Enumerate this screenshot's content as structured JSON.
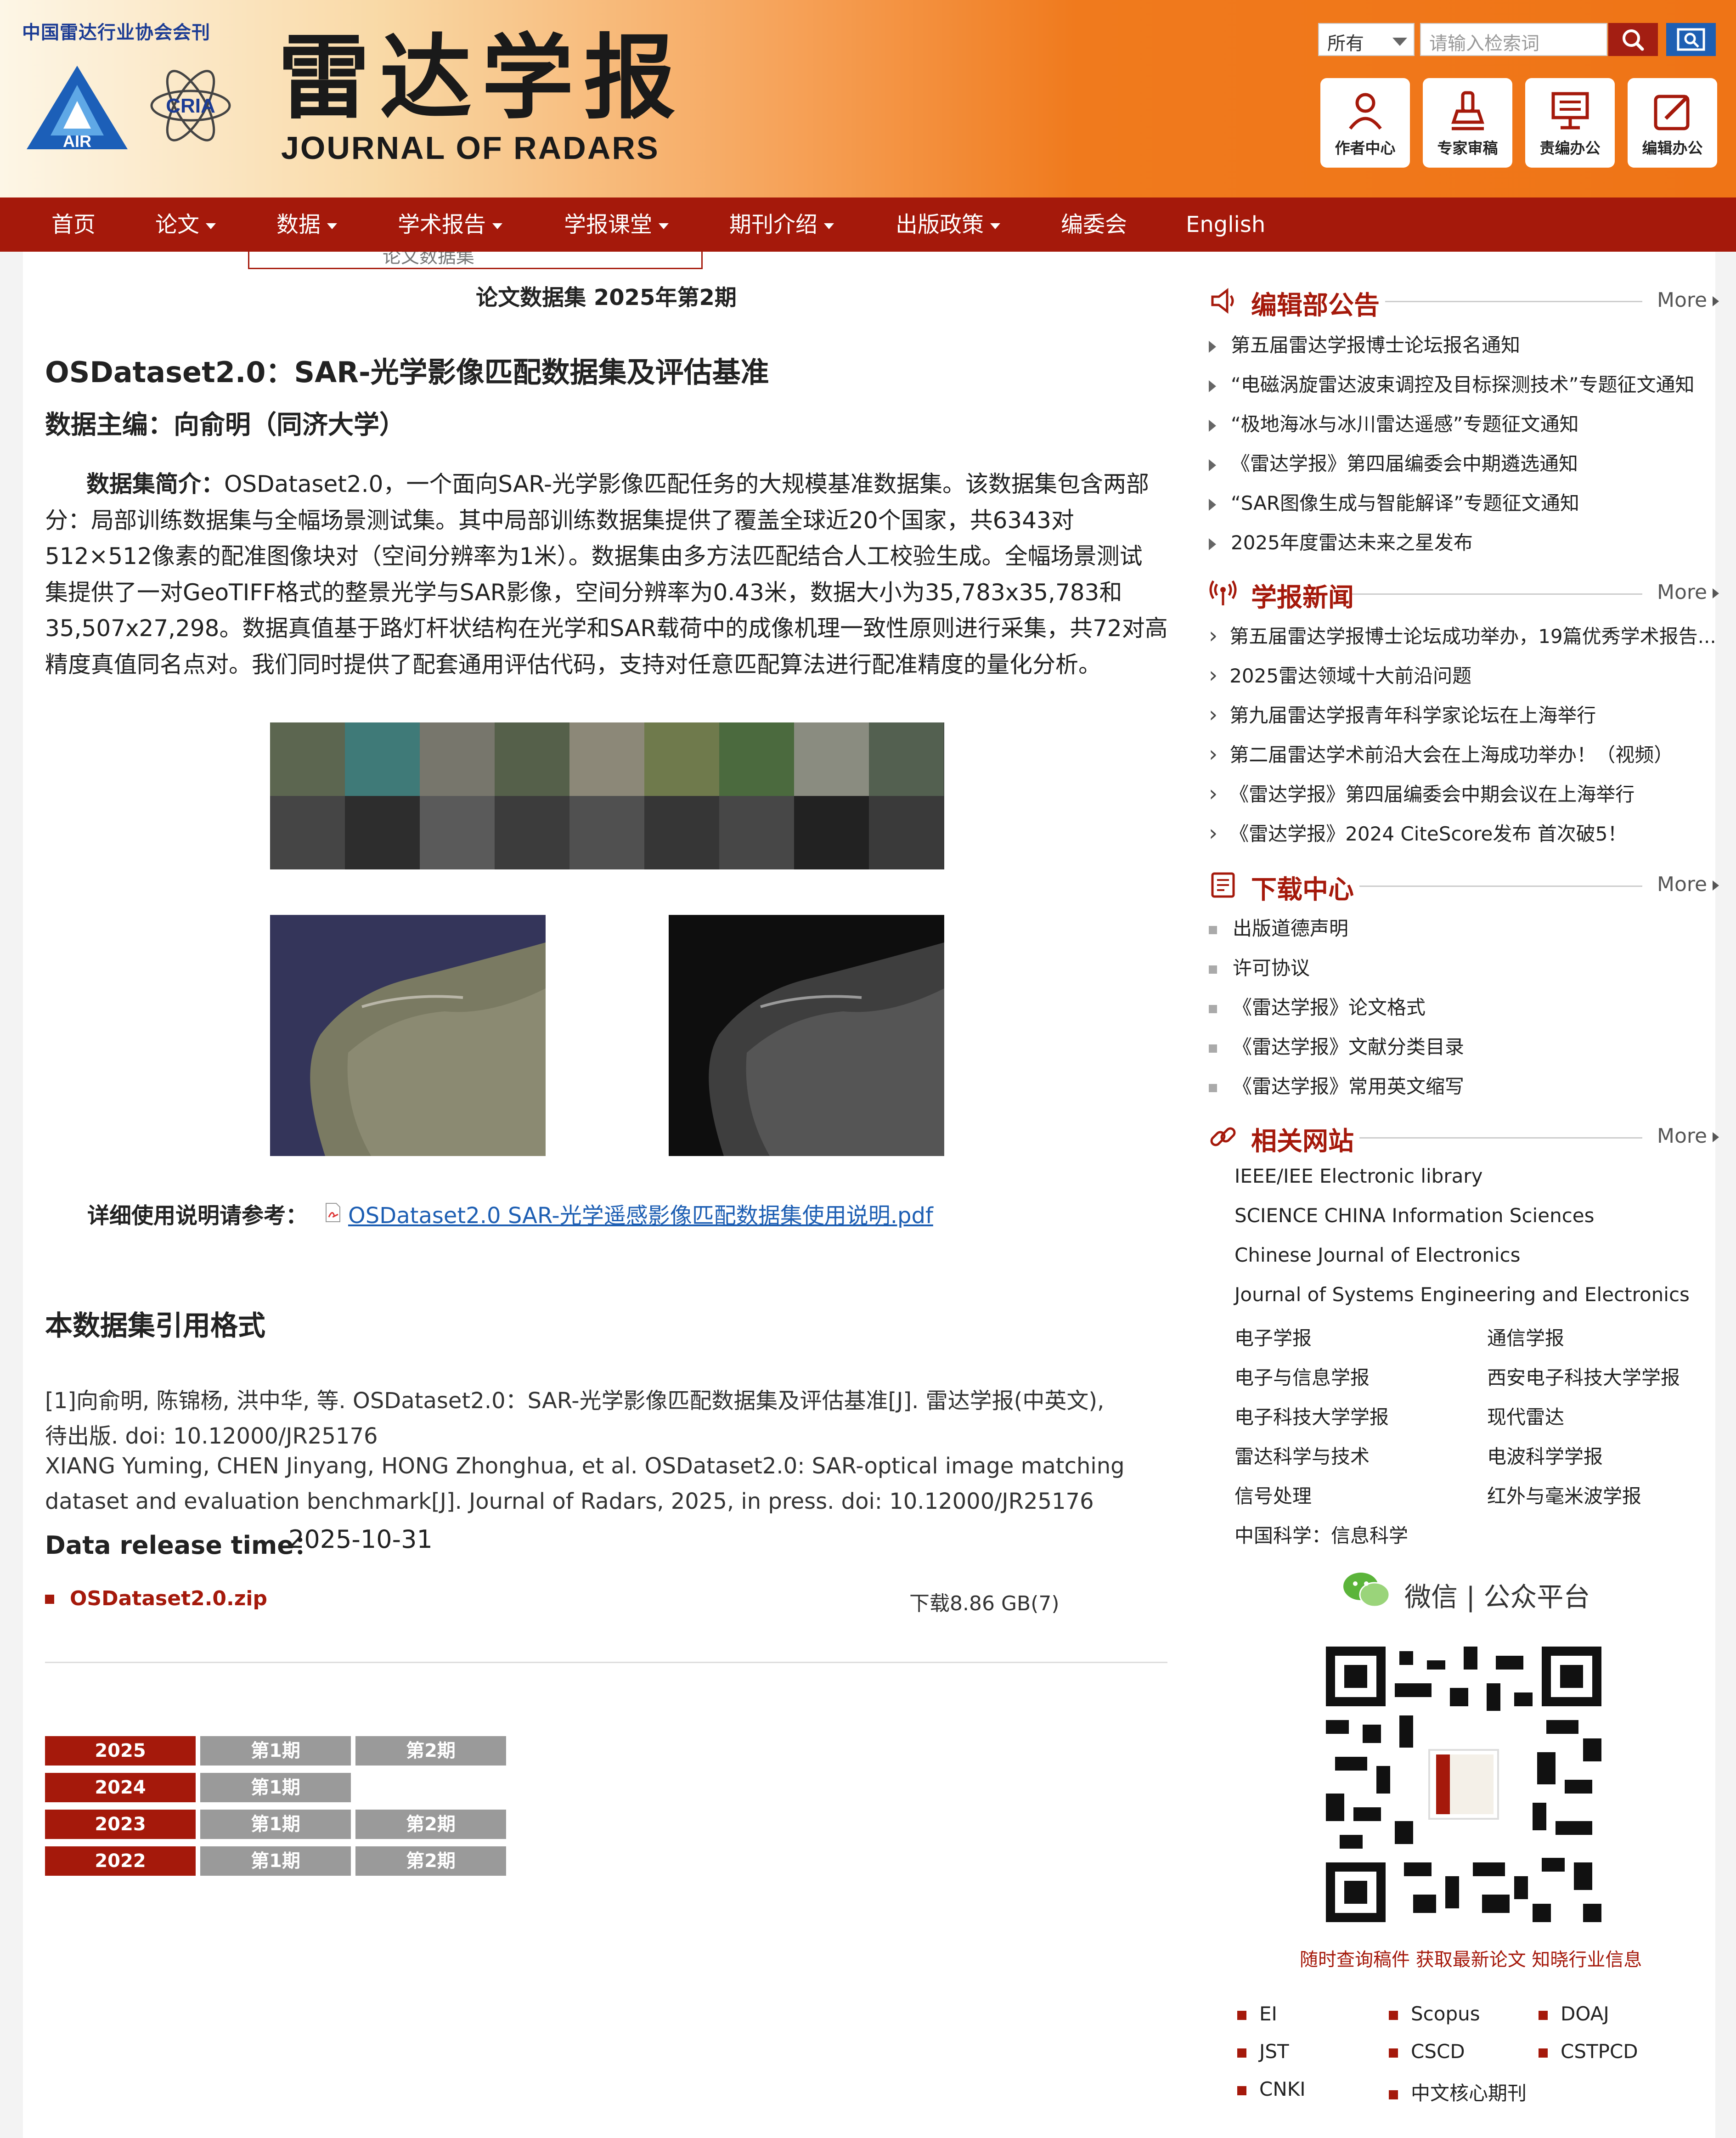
{
  "header": {
    "association": "中国雷达行业协会会刊",
    "logo_air_text": "AIR",
    "logo_cria_text": "CRIA",
    "title_cn": "雷达学报",
    "title_en": "JOURNAL OF RADARS",
    "search_scope": "所有",
    "search_placeholder": "请输入检索词",
    "tools": [
      {
        "label": "作者中心",
        "icon": "author-icon"
      },
      {
        "label": "专家审稿",
        "icon": "reviewer-icon"
      },
      {
        "label": "责编办公",
        "icon": "editor-office-icon"
      },
      {
        "label": "编辑办公",
        "icon": "edit-office-icon"
      }
    ],
    "colors": {
      "brand": "#a5190b",
      "accent": "#ef7416",
      "link": "#1e5fb3"
    }
  },
  "nav": {
    "items": [
      "首页",
      "论文",
      "数据",
      "学术报告",
      "学报课堂",
      "期刊介绍",
      "出版政策",
      "编委会",
      "English"
    ],
    "dropdown_hint": "论文数据集"
  },
  "main": {
    "issue_title": "论文数据集 2025年第2期",
    "article_title": "OSDataset2.0：SAR-光学影像匹配数据集及评估基准",
    "editor": "数据主编：向俞明（同济大学）",
    "intro_label": "数据集简介：",
    "intro_lines": [
      "OSDataset2.0，一个面向SAR-光学影像匹配任务的大规模基准数据集。该数据集包含两部",
      "分：局部训练数据集与全幅场景测试集。其中局部训练数据集提供了覆盖全球近20个国家，共6343对",
      "512×512像素的配准图像块对（空间分辨率为1米）。数据集由多方法匹配结合人工校验生成。全幅场景测试",
      "集提供了一对GeoTIFF格式的整景光学与SAR影像，空间分辨率为0.43米，数据大小为35,783x35,783和",
      "35,507x27,298。数据真值基于路灯杆状结构在光学和SAR载荷中的成像机理一致性原则进行采集，共72对高",
      "精度真值同名点对。我们同时提供了配套通用评估代码，支持对任意匹配算法进行配准精度的量化分析。"
    ],
    "detail_label": "详细使用说明请参考：",
    "detail_link": "OSDataset2.0 SAR-光学遥感影像匹配数据集使用说明.pdf",
    "cite_heading": "本数据集引用格式",
    "cite_lines": [
      "[1]向俞明, 陈锦杨, 洪中华, 等. OSDataset2.0：SAR-光学影像匹配数据集及评估基准[J].  雷达学报(中英文),",
      "待出版. doi: 10.12000/JR25176",
      "XIANG Yuming, CHEN Jinyang, HONG Zhonghua, et al. OSDataset2.0: SAR-optical image matching",
      "dataset and evaluation benchmark[J]. Journal of Radars, 2025, in press. doi: 10.12000/JR25176"
    ],
    "release_label": "Data release time：",
    "release_value": "2025-10-31",
    "file_name": "OSDataset2.0.zip",
    "file_size": "下载8.86 GB(7)",
    "archive": [
      {
        "year": "2025",
        "issues": [
          "第1期",
          "第2期"
        ]
      },
      {
        "year": "2024",
        "issues": [
          "第1期"
        ]
      },
      {
        "year": "2023",
        "issues": [
          "第1期",
          "第2期"
        ]
      },
      {
        "year": "2022",
        "issues": [
          "第1期",
          "第2期"
        ]
      }
    ]
  },
  "sidebar": {
    "more_label": "More",
    "announcements": {
      "title": "编辑部公告",
      "items": [
        "第五届雷达学报博士论坛报名通知",
        "“电磁涡旋雷达波束调控及目标探测技术”专题征文通知",
        "“极地海冰与冰川雷达遥感”专题征文通知",
        "《雷达学报》第四届编委会中期遴选通知",
        "“SAR图像生成与智能解译”专题征文通知",
        "2025年度雷达未来之星发布"
      ]
    },
    "news": {
      "title": "学报新闻",
      "items": [
        "第五届雷达学报博士论坛成功举办，19篇优秀学术报告...",
        "2025雷达领域十大前沿问题",
        "第九届雷达学报青年科学家论坛在上海举行",
        "第二届雷达学术前沿大会在上海成功举办！（视频）",
        "《雷达学报》第四届编委会中期会议在上海举行",
        "《雷达学报》2024 CiteScore发布 首次破5！"
      ]
    },
    "downloads": {
      "title": "下载中心",
      "items": [
        "出版道德声明",
        "许可协议",
        "《雷达学报》论文格式",
        "《雷达学报》文献分类目录",
        "《雷达学报》常用英文缩写"
      ]
    },
    "sites": {
      "title": "相关网站",
      "full": [
        "IEEE/IEE Electronic library",
        "SCIENCE CHINA Information Sciences",
        "Chinese Journal of Electronics",
        "Journal of Systems Engineering and Electronics"
      ],
      "pairs": [
        [
          "电子学报",
          "通信学报"
        ],
        [
          "电子与信息学报",
          "西安电子科技大学学报"
        ],
        [
          "电子科技大学学报",
          "现代雷达"
        ],
        [
          "雷达科学与技术",
          "电波科学学报"
        ],
        [
          "信号处理",
          "红外与毫米波学报"
        ],
        [
          "中国科学：信息科学",
          ""
        ]
      ]
    },
    "wechat_label": "微信 | 公众平台",
    "qr_caption": "随时查询稿件 获取最新论文 知晓行业信息",
    "indexes": [
      [
        "EI",
        "Scopus",
        "DOAJ"
      ],
      [
        "JST",
        "CSCD",
        "CSTPCD"
      ],
      [
        "CNKI",
        "中文核心期刊",
        ""
      ]
    ]
  }
}
